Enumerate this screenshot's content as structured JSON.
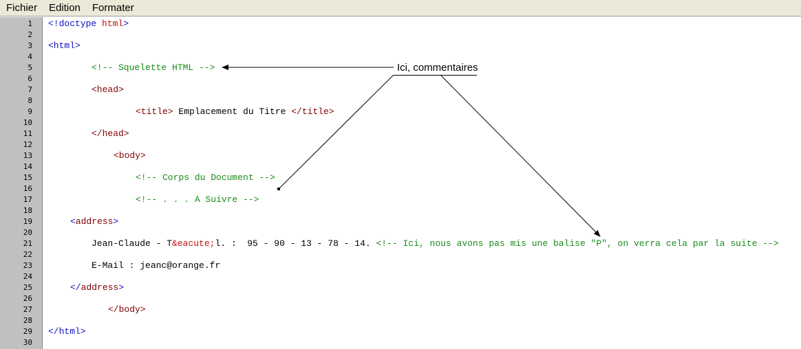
{
  "menu": {
    "items": [
      "Fichier",
      "Edition",
      "Formater"
    ]
  },
  "line_numbers": [
    "1",
    "2",
    "3",
    "4",
    "5",
    "6",
    "7",
    "8",
    "9",
    "10",
    "11",
    "12",
    "13",
    "14",
    "15",
    "16",
    "17",
    "18",
    "19",
    "20",
    "21",
    "22",
    "23",
    "24",
    "25",
    "26",
    "27",
    "28",
    "29",
    "30"
  ],
  "code": {
    "l1_a": "<!doctype ",
    "l1_b": "html",
    "l1_c": ">",
    "l3": "<html>",
    "l5": "<!-- Squelette HTML -->",
    "l7": "<head>",
    "l9_a": "<title>",
    "l9_b": " Emplacement du Titre ",
    "l9_c": "</title>",
    "l11": "</head>",
    "l13": "<body>",
    "l15": "<!-- Corps du Document -->",
    "l17": "<!-- . . . A Suivre -->",
    "l19_a": "<",
    "l19_b": "address",
    "l19_c": ">",
    "l21_a": "Jean-Claude - T",
    "l21_b": "&eacute;",
    "l21_c": "l. :  95 - 90 - 13 - 78 - 14. ",
    "l21_d": "<!-- Ici, nous avons pas mis une balise \"P\", on verra cela par la suite -->",
    "l23": "E-Mail : jeanc@orange.fr",
    "l25_a": "</",
    "l25_b": "address",
    "l25_c": ">",
    "l27": "</body>",
    "l29": "</html>"
  },
  "annotation": {
    "label": "Ici, commentaires"
  },
  "colors": {
    "tag": "#1010c0",
    "keyword": "#c01010",
    "comment": "#1a8a1a",
    "gutter": "#c0c0c0",
    "menubar": "#ece9d8"
  }
}
